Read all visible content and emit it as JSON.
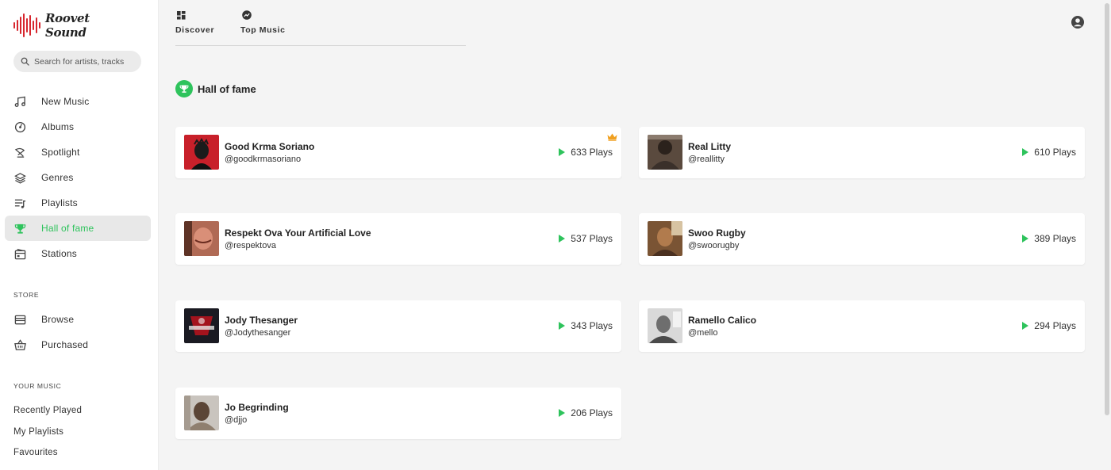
{
  "app": {
    "name": "Roovet Sound"
  },
  "search": {
    "placeholder": "Search for artists, tracks"
  },
  "sidebar": {
    "nav": [
      {
        "label": "New Music",
        "icon": "music-note-icon"
      },
      {
        "label": "Albums",
        "icon": "album-icon"
      },
      {
        "label": "Spotlight",
        "icon": "spotlight-icon"
      },
      {
        "label": "Genres",
        "icon": "layers-icon"
      },
      {
        "label": "Playlists",
        "icon": "playlist-icon"
      },
      {
        "label": "Hall of fame",
        "icon": "trophy-icon",
        "active": true
      },
      {
        "label": "Stations",
        "icon": "radio-icon"
      }
    ],
    "store_title": "STORE",
    "store": [
      {
        "label": "Browse",
        "icon": "browse-icon"
      },
      {
        "label": "Purchased",
        "icon": "basket-icon"
      }
    ],
    "your_music_title": "YOUR MUSIC",
    "your_music": [
      {
        "label": "Recently Played"
      },
      {
        "label": "My Playlists"
      },
      {
        "label": "Favourites"
      }
    ]
  },
  "topnav": {
    "tabs": [
      {
        "label": "Discover",
        "icon": "grid-icon"
      },
      {
        "label": "Top Music",
        "icon": "trending-icon"
      }
    ]
  },
  "section": {
    "title": "Hall of fame",
    "icon": "trophy-icon"
  },
  "colors": {
    "accent": "#2ec35c",
    "brand": "#d7262e",
    "crown": "#f0a020"
  },
  "artists": [
    {
      "name": "Good Krma Soriano",
      "handle": "@goodkrmasoriano",
      "plays": "633 Plays",
      "top": true
    },
    {
      "name": "Real Litty",
      "handle": "@reallitty",
      "plays": "610 Plays"
    },
    {
      "name": "Respekt Ova Your Artificial Love",
      "handle": "@respektova",
      "plays": "537 Plays"
    },
    {
      "name": "Swoo Rugby",
      "handle": "@swoorugby",
      "plays": "389 Plays"
    },
    {
      "name": "Jody Thesanger",
      "handle": "@Jodythesanger",
      "plays": "343 Plays"
    },
    {
      "name": "Ramello Calico",
      "handle": "@mello",
      "plays": "294 Plays"
    },
    {
      "name": "Jo Begrinding",
      "handle": "@djjo",
      "plays": "206 Plays"
    }
  ]
}
